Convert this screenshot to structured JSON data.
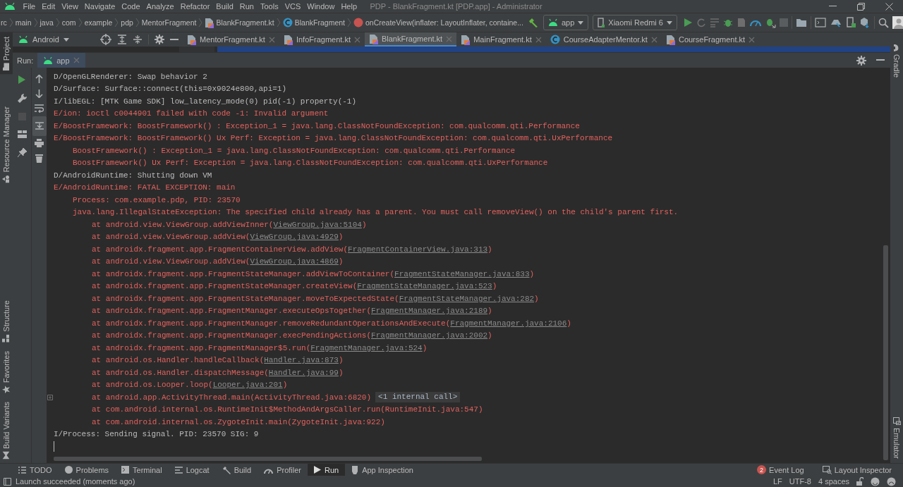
{
  "window": {
    "title": "PDP - BlankFragment.kt [PDP.app] - Administrator"
  },
  "menu": [
    "File",
    "Edit",
    "View",
    "Navigate",
    "Code",
    "Analyze",
    "Refactor",
    "Build",
    "Run",
    "Tools",
    "VCS",
    "Window",
    "Help"
  ],
  "breadcrumbs": [
    {
      "label": "rc",
      "kind": "plain"
    },
    {
      "label": "main",
      "kind": "plain"
    },
    {
      "label": "java",
      "kind": "plain"
    },
    {
      "label": "com",
      "kind": "plain"
    },
    {
      "label": "example",
      "kind": "plain"
    },
    {
      "label": "pdp",
      "kind": "plain"
    },
    {
      "label": "MentorFragment",
      "kind": "plain"
    },
    {
      "label": "BlankFragment.kt",
      "kind": "kotlin-file"
    },
    {
      "label": "BlankFragment",
      "kind": "class"
    },
    {
      "label": "onCreateView(inflater: LayoutInflater, containe...",
      "kind": "method"
    }
  ],
  "run_config": {
    "label": "app"
  },
  "device": {
    "label": "Xiaomi Redmi 6"
  },
  "project_view": {
    "label": "Android"
  },
  "editor_tabs": [
    {
      "label": "MentorFragment.kt",
      "kind": "kotlin-file",
      "selected": false
    },
    {
      "label": "InfoFragment.kt",
      "kind": "kotlin-file",
      "selected": false
    },
    {
      "label": "BlankFragment.kt",
      "kind": "kotlin-file",
      "selected": true
    },
    {
      "label": "MainFragment.kt",
      "kind": "kotlin-file",
      "selected": false
    },
    {
      "label": "CourseAdapterMentor.kt",
      "kind": "class",
      "selected": false
    },
    {
      "label": "CourseFragment.kt",
      "kind": "kotlin-file",
      "selected": false
    }
  ],
  "left_stripe": {
    "top": [
      {
        "label": "Project",
        "kind": "project"
      },
      {
        "label": "Resource Manager",
        "kind": "resources"
      }
    ],
    "bottom": [
      {
        "label": "Structure",
        "kind": "structure"
      },
      {
        "label": "Favorites",
        "kind": "favorites"
      },
      {
        "label": "Build Variants",
        "kind": "variants"
      }
    ]
  },
  "right_stripe": {
    "top": [
      {
        "label": "Gradle",
        "kind": "gradle"
      }
    ],
    "bottom": [
      {
        "label": "Emulator",
        "kind": "emulator"
      }
    ]
  },
  "run_panel": {
    "label": "Run:",
    "tabs": [
      {
        "label": "app",
        "selected": true
      }
    ]
  },
  "console": {
    "lines": [
      {
        "text": "D/OpenGLRenderer: Swap behavior 2",
        "color": "#bbbbbb",
        "kind": "head"
      },
      {
        "text": "D/Surface: Surface::connect(this=0x9024e800,api=1)",
        "color": "#bbbbbb",
        "kind": "head"
      },
      {
        "text": "I/libEGL: [MTK Game SDK] low_latency_mode(0) pid(-1) property(-1)",
        "color": "#bbbbbb",
        "kind": "head"
      },
      {
        "text": "E/ion: ioctl c0044901 failed with code -1: Invalid argument",
        "color": "#e3625e",
        "kind": "head"
      },
      {
        "text": "E/BoostFramework: BoostFramework() : Exception_1 = java.lang.ClassNotFoundException: com.qualcomm.qti.Performance",
        "color": "#e3625e",
        "kind": "head"
      },
      {
        "text": "E/BoostFramework: BoostFramework() Ux Perf: Exception = java.lang.ClassNotFoundException: com.qualcomm.qti.UxPerformance",
        "color": "#e3625e",
        "kind": "head"
      },
      {
        "text": "BoostFramework() : Exception_1 = java.lang.ClassNotFoundException: com.qualcomm.qti.Performance",
        "color": "#e3625e",
        "kind": "detail"
      },
      {
        "text": "BoostFramework() Ux Perf: Exception = java.lang.ClassNotFoundException: com.qualcomm.qti.UxPerformance",
        "color": "#e3625e",
        "kind": "detail"
      },
      {
        "text": "D/AndroidRuntime: Shutting down VM",
        "color": "#bbbbbb",
        "kind": "head"
      },
      {
        "text": "E/AndroidRuntime: FATAL EXCEPTION: main",
        "color": "#e3625e",
        "kind": "head"
      },
      {
        "text": "Process: com.example.pdp, PID: 23570",
        "color": "#e3625e",
        "kind": "detail"
      },
      {
        "text": "java.lang.IllegalStateException: The specified child already has a parent. You must call removeView() on the child's parent first.",
        "color": "#e3625e",
        "kind": "detail"
      },
      {
        "text": "at android.view.ViewGroup.addViewInner(",
        "link": "ViewGroup.java:5104",
        "after": ")",
        "color": "#e3625e",
        "kind": "frame"
      },
      {
        "text": "at android.view.ViewGroup.addView(",
        "link": "ViewGroup.java:4929",
        "after": ")",
        "color": "#e3625e",
        "kind": "frame"
      },
      {
        "text": "at androidx.fragment.app.FragmentContainerView.addView(",
        "link": "FragmentContainerView.java:313",
        "after": ")",
        "color": "#e3625e",
        "kind": "frame"
      },
      {
        "text": "at android.view.ViewGroup.addView(",
        "link": "ViewGroup.java:4869",
        "after": ")",
        "color": "#e3625e",
        "kind": "frame"
      },
      {
        "text": "at androidx.fragment.app.FragmentStateManager.addViewToContainer(",
        "link": "FragmentStateManager.java:833",
        "after": ")",
        "color": "#e3625e",
        "kind": "frame"
      },
      {
        "text": "at androidx.fragment.app.FragmentStateManager.createView(",
        "link": "FragmentStateManager.java:523",
        "after": ")",
        "color": "#e3625e",
        "kind": "frame"
      },
      {
        "text": "at androidx.fragment.app.FragmentStateManager.moveToExpectedState(",
        "link": "FragmentStateManager.java:282",
        "after": ")",
        "color": "#e3625e",
        "kind": "frame"
      },
      {
        "text": "at androidx.fragment.app.FragmentManager.executeOpsTogether(",
        "link": "FragmentManager.java:2189",
        "after": ")",
        "color": "#e3625e",
        "kind": "frame"
      },
      {
        "text": "at androidx.fragment.app.FragmentManager.removeRedundantOperationsAndExecute(",
        "link": "FragmentManager.java:2106",
        "after": ")",
        "color": "#e3625e",
        "kind": "frame"
      },
      {
        "text": "at androidx.fragment.app.FragmentManager.execPendingActions(",
        "link": "FragmentManager.java:2002",
        "after": ")",
        "color": "#e3625e",
        "kind": "frame"
      },
      {
        "text": "at androidx.fragment.app.FragmentManager$5.run(",
        "link": "FragmentManager.java:524",
        "after": ")",
        "color": "#e3625e",
        "kind": "frame"
      },
      {
        "text": "at android.os.Handler.handleCallback(",
        "link": "Handler.java:873",
        "after": ")",
        "color": "#e3625e",
        "kind": "frame"
      },
      {
        "text": "at android.os.Handler.dispatchMessage(",
        "link": "Handler.java:99",
        "after": ")",
        "color": "#e3625e",
        "kind": "frame"
      },
      {
        "text": "at android.os.Looper.loop(",
        "link": "Looper.java:201",
        "after": ")",
        "color": "#e3625e",
        "kind": "frame"
      },
      {
        "text": "at android.app.ActivityThread.main(ActivityThread.java:6820)",
        "badge": "<1 internal call>",
        "folded": true,
        "color": "#e3625e",
        "kind": "frame"
      },
      {
        "text": "at com.android.internal.os.RuntimeInit$MethodAndArgsCaller.run(RuntimeInit.java:547)",
        "color": "#e3625e",
        "kind": "frame"
      },
      {
        "text": "at com.android.internal.os.ZygoteInit.main(ZygoteInit.java:922)",
        "color": "#e3625e",
        "kind": "frame"
      },
      {
        "text": "I/Process: Sending signal. PID: 23570 SIG: 9",
        "color": "#bbbbbb",
        "kind": "head"
      }
    ]
  },
  "bottom_tools": [
    {
      "label": "TODO",
      "kind": "todo",
      "selected": false
    },
    {
      "label": "Problems",
      "kind": "problems",
      "selected": false
    },
    {
      "label": "Terminal",
      "kind": "terminal",
      "selected": false
    },
    {
      "label": "Logcat",
      "kind": "logcat",
      "selected": false
    },
    {
      "label": "Build",
      "kind": "build",
      "selected": false
    },
    {
      "label": "Profiler",
      "kind": "profiler",
      "selected": false
    },
    {
      "label": "Run",
      "kind": "run",
      "selected": true
    },
    {
      "label": "App Inspection",
      "kind": "inspection",
      "selected": false
    }
  ],
  "right_tools": [
    {
      "label": "Event Log",
      "badge": "2"
    },
    {
      "label": "Layout Inspector"
    }
  ],
  "status_bar": {
    "message": "Launch succeeded (moments ago)",
    "items": [
      "LF",
      "UTF-8",
      "4 spaces"
    ]
  }
}
